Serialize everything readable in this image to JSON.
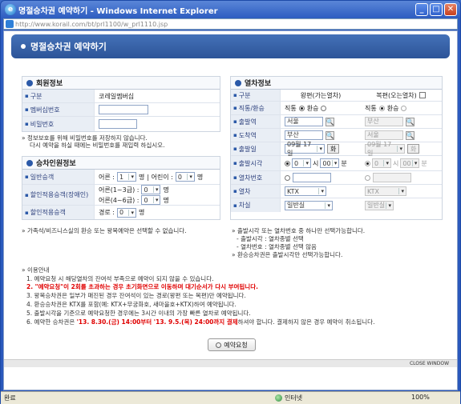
{
  "window": {
    "title": "명절승차권 예약하기 - Windows Internet Explorer",
    "url": "http://www.korail.com/bt/prl1100/w_prl1110.jsp"
  },
  "header": {
    "title": "명절승차권 예약하기"
  },
  "member": {
    "title": "회원정보",
    "rows": [
      {
        "label": "구분",
        "value": "코레일멤버십"
      },
      {
        "label": "멤버십번호",
        "value": ""
      },
      {
        "label": "비밀번호",
        "value": ""
      }
    ],
    "note1": "» 정보보호를 위해 비밀번호를 저장하지 않습니다.",
    "note2": "다시 예약을 하실 때에는 비밀번호를 재입력 하십시오."
  },
  "passenger": {
    "title": "승차인원정보",
    "general_label": "일반승객",
    "adult_label": "어른 :",
    "adult_value": "1",
    "unit": "명",
    "child_label": "| 어린이 :",
    "child_value": "0",
    "disabled_label": "할인적용승객(장애인)",
    "dis13_label": "어른(1~3급) :",
    "dis13_value": "0",
    "dis46_label": "어른(4~6급) :",
    "dis46_value": "0",
    "senior_label": "할인적용승객",
    "senior_sub": "경로 :",
    "senior_value": "0"
  },
  "train": {
    "title": "열차정보",
    "col_label": "구분",
    "col_outbound": "왕편(가는열차)",
    "col_return": "복편(오는열차)",
    "rows": {
      "trip_type": "직통/환승",
      "direct": "직통",
      "transfer": "환승",
      "dep": "출발역",
      "dep_out": "서울",
      "dep_ret": "부산",
      "arr": "도착역",
      "arr_out": "부산",
      "arr_ret": "서울",
      "date": "출발일",
      "date_out": "09월 17일",
      "date_ret": "09월 17일",
      "day_btn": "화",
      "time": "출발시각",
      "hour_out": "0",
      "hour_unit": "시",
      "min_out": "00",
      "min_unit": "분",
      "hour_ret": "0",
      "min_ret": "00",
      "trainno": "열차번호",
      "train": "열차",
      "train_out": "KTX",
      "train_ret": "KTX",
      "car": "차실",
      "car_out": "일반실",
      "car_ret": "일반실"
    }
  },
  "notes_left": "» 가족석/비즈니스실의 환승 또는 왕복예약은 선택할 수 없습니다.",
  "notes_right": [
    "» 출발시각 또는 열차번호 중 하나만 선택가능합니다.",
    "- 출발시각 : 열차종별 선택",
    "- 열차번호 : 열차종별 선택 않음",
    "» 환승승차권은 출발시각만 선택가능합니다."
  ],
  "usage": {
    "title": "» 이용안내",
    "items": [
      "1. 예약요청 시 해당열차의 잔여석 부족으로 예약이 되지 않을 수 있습니다.",
      "2. \"예약요청\"이 2회를 초과하는 경우 초기화면으로 이동하며 대기순서가 다시 부여됩니다.",
      "3. 왕복승차권은 일부가 매진된 경우 잔여석이 있는 경로(왕편 또는 복편)만 예약됩니다.",
      "4. 환승승차권은 KTX를 포함(예: KTX+무궁화호, 새마을호+KTX)하여 예약됩니다.",
      "5. 출발시각을 기준으로 예약요청한 경우에는 3시간 이내의 가장 빠른 열차로 예약됩니다."
    ],
    "item6_pre": "6. 예약한 승차권은 ",
    "item6_red": "'13. 8.30.(금) 14:00부터 '13. 9.5.(목) 24:00까지 결제",
    "item6_post": "하셔야 합니다. 결제하지 않은 경우 예약이 취소됩니다."
  },
  "request_button": "예약요청",
  "close_window": "CLOSE WINDOW",
  "status": {
    "left": "완료",
    "zone": "인터넷",
    "zoom": "100%"
  }
}
